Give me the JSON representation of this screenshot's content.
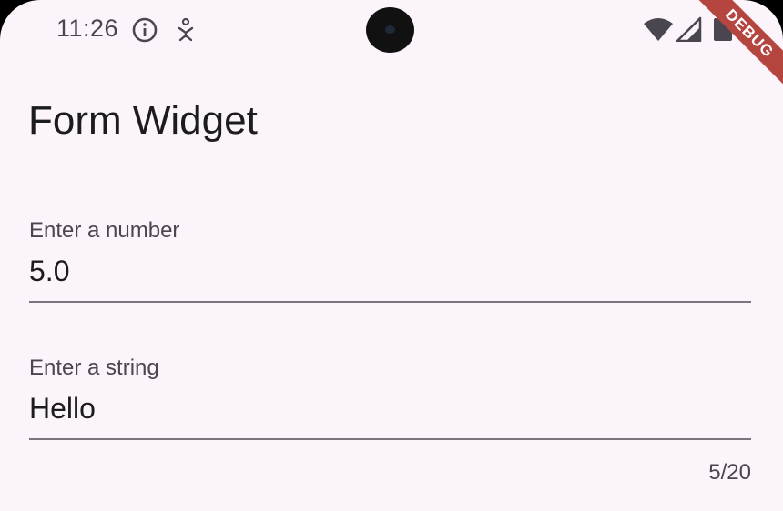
{
  "status_bar": {
    "time": "11:26",
    "icons": [
      "info-icon",
      "accessibility-icon",
      "wifi-icon",
      "signal-icon",
      "battery-icon"
    ]
  },
  "debug_banner": {
    "label": "DEBUG",
    "color": "#b5463f"
  },
  "app_bar": {
    "title": "Form Widget"
  },
  "form": {
    "number_field": {
      "label": "Enter a number",
      "value": "5.0"
    },
    "string_field": {
      "label": "Enter a string",
      "value": "Hello",
      "counter": "5/20"
    }
  },
  "colors": {
    "background": "#fcf4fb",
    "text": "#1c1b1f",
    "label": "#4a4650",
    "underline": "#79747e"
  }
}
